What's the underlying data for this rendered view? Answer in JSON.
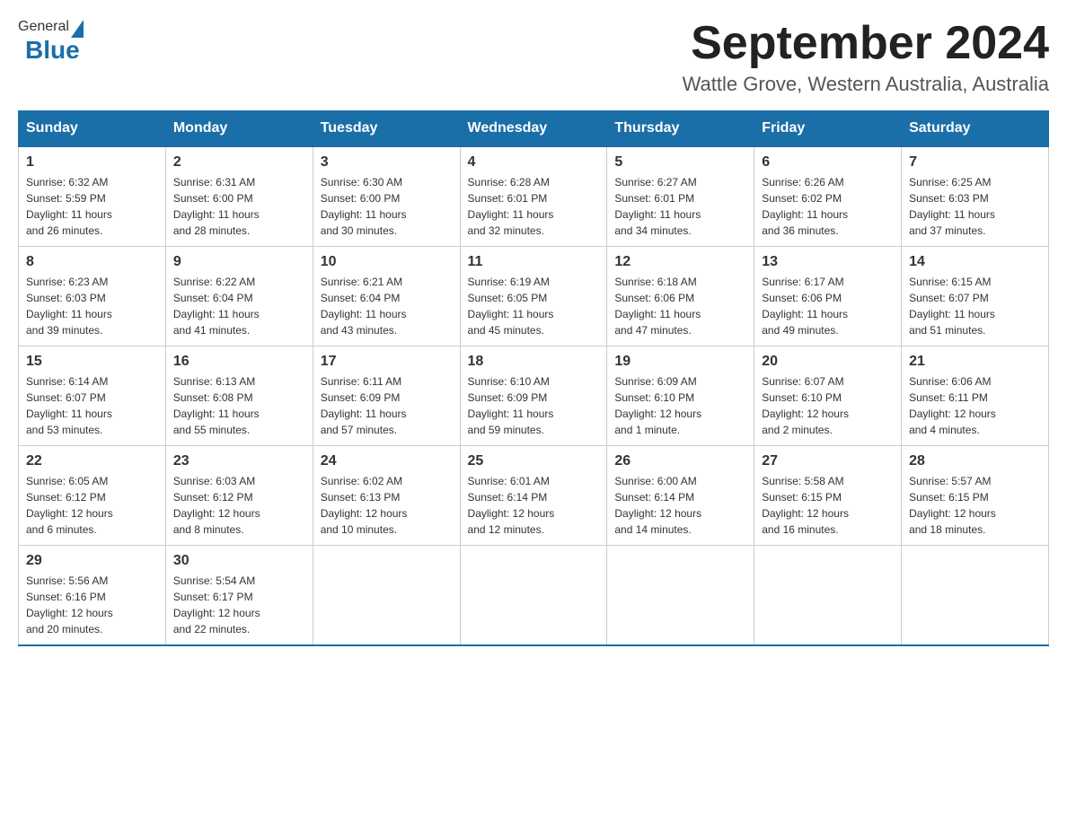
{
  "header": {
    "logo": {
      "general": "General",
      "blue": "Blue"
    },
    "title": "September 2024",
    "location": "Wattle Grove, Western Australia, Australia"
  },
  "days_of_week": [
    "Sunday",
    "Monday",
    "Tuesday",
    "Wednesday",
    "Thursday",
    "Friday",
    "Saturday"
  ],
  "weeks": [
    [
      {
        "day": "1",
        "sunrise": "6:32 AM",
        "sunset": "5:59 PM",
        "daylight": "11 hours and 26 minutes."
      },
      {
        "day": "2",
        "sunrise": "6:31 AM",
        "sunset": "6:00 PM",
        "daylight": "11 hours and 28 minutes."
      },
      {
        "day": "3",
        "sunrise": "6:30 AM",
        "sunset": "6:00 PM",
        "daylight": "11 hours and 30 minutes."
      },
      {
        "day": "4",
        "sunrise": "6:28 AM",
        "sunset": "6:01 PM",
        "daylight": "11 hours and 32 minutes."
      },
      {
        "day": "5",
        "sunrise": "6:27 AM",
        "sunset": "6:01 PM",
        "daylight": "11 hours and 34 minutes."
      },
      {
        "day": "6",
        "sunrise": "6:26 AM",
        "sunset": "6:02 PM",
        "daylight": "11 hours and 36 minutes."
      },
      {
        "day": "7",
        "sunrise": "6:25 AM",
        "sunset": "6:03 PM",
        "daylight": "11 hours and 37 minutes."
      }
    ],
    [
      {
        "day": "8",
        "sunrise": "6:23 AM",
        "sunset": "6:03 PM",
        "daylight": "11 hours and 39 minutes."
      },
      {
        "day": "9",
        "sunrise": "6:22 AM",
        "sunset": "6:04 PM",
        "daylight": "11 hours and 41 minutes."
      },
      {
        "day": "10",
        "sunrise": "6:21 AM",
        "sunset": "6:04 PM",
        "daylight": "11 hours and 43 minutes."
      },
      {
        "day": "11",
        "sunrise": "6:19 AM",
        "sunset": "6:05 PM",
        "daylight": "11 hours and 45 minutes."
      },
      {
        "day": "12",
        "sunrise": "6:18 AM",
        "sunset": "6:06 PM",
        "daylight": "11 hours and 47 minutes."
      },
      {
        "day": "13",
        "sunrise": "6:17 AM",
        "sunset": "6:06 PM",
        "daylight": "11 hours and 49 minutes."
      },
      {
        "day": "14",
        "sunrise": "6:15 AM",
        "sunset": "6:07 PM",
        "daylight": "11 hours and 51 minutes."
      }
    ],
    [
      {
        "day": "15",
        "sunrise": "6:14 AM",
        "sunset": "6:07 PM",
        "daylight": "11 hours and 53 minutes."
      },
      {
        "day": "16",
        "sunrise": "6:13 AM",
        "sunset": "6:08 PM",
        "daylight": "11 hours and 55 minutes."
      },
      {
        "day": "17",
        "sunrise": "6:11 AM",
        "sunset": "6:09 PM",
        "daylight": "11 hours and 57 minutes."
      },
      {
        "day": "18",
        "sunrise": "6:10 AM",
        "sunset": "6:09 PM",
        "daylight": "11 hours and 59 minutes."
      },
      {
        "day": "19",
        "sunrise": "6:09 AM",
        "sunset": "6:10 PM",
        "daylight": "12 hours and 1 minute."
      },
      {
        "day": "20",
        "sunrise": "6:07 AM",
        "sunset": "6:10 PM",
        "daylight": "12 hours and 2 minutes."
      },
      {
        "day": "21",
        "sunrise": "6:06 AM",
        "sunset": "6:11 PM",
        "daylight": "12 hours and 4 minutes."
      }
    ],
    [
      {
        "day": "22",
        "sunrise": "6:05 AM",
        "sunset": "6:12 PM",
        "daylight": "12 hours and 6 minutes."
      },
      {
        "day": "23",
        "sunrise": "6:03 AM",
        "sunset": "6:12 PM",
        "daylight": "12 hours and 8 minutes."
      },
      {
        "day": "24",
        "sunrise": "6:02 AM",
        "sunset": "6:13 PM",
        "daylight": "12 hours and 10 minutes."
      },
      {
        "day": "25",
        "sunrise": "6:01 AM",
        "sunset": "6:14 PM",
        "daylight": "12 hours and 12 minutes."
      },
      {
        "day": "26",
        "sunrise": "6:00 AM",
        "sunset": "6:14 PM",
        "daylight": "12 hours and 14 minutes."
      },
      {
        "day": "27",
        "sunrise": "5:58 AM",
        "sunset": "6:15 PM",
        "daylight": "12 hours and 16 minutes."
      },
      {
        "day": "28",
        "sunrise": "5:57 AM",
        "sunset": "6:15 PM",
        "daylight": "12 hours and 18 minutes."
      }
    ],
    [
      {
        "day": "29",
        "sunrise": "5:56 AM",
        "sunset": "6:16 PM",
        "daylight": "12 hours and 20 minutes."
      },
      {
        "day": "30",
        "sunrise": "5:54 AM",
        "sunset": "6:17 PM",
        "daylight": "12 hours and 22 minutes."
      },
      null,
      null,
      null,
      null,
      null
    ]
  ],
  "labels": {
    "sunrise": "Sunrise:",
    "sunset": "Sunset:",
    "daylight": "Daylight:"
  }
}
